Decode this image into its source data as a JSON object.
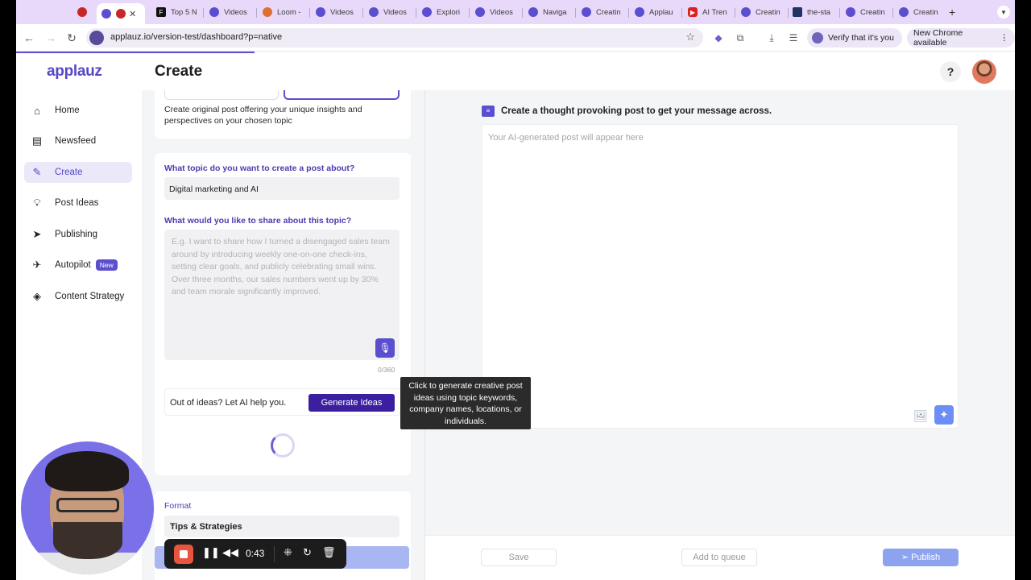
{
  "browser": {
    "tabs": [
      {
        "label": "",
        "icon": "record-icon",
        "color": "#c62828"
      },
      {
        "label": "",
        "icon": "applauz-icon",
        "color": "#5b4fcf"
      },
      {
        "label": "Top 5 N",
        "icon": "f-icon",
        "color": "#111111"
      },
      {
        "label": "Videos",
        "icon": "applauz-icon",
        "color": "#5b4fcf"
      },
      {
        "label": "Loom -",
        "icon": "loom-icon",
        "color": "#e07030"
      },
      {
        "label": "Videos",
        "icon": "applauz-icon",
        "color": "#5b4fcf"
      },
      {
        "label": "Videos",
        "icon": "applauz-icon",
        "color": "#5b4fcf"
      },
      {
        "label": "Explori",
        "icon": "applauz-icon",
        "color": "#5b4fcf"
      },
      {
        "label": "Videos",
        "icon": "applauz-icon",
        "color": "#5b4fcf"
      },
      {
        "label": "Naviga",
        "icon": "applauz-icon",
        "color": "#5b4fcf"
      },
      {
        "label": "Creatin",
        "icon": "applauz-icon",
        "color": "#5b4fcf"
      },
      {
        "label": "Applau",
        "icon": "applauz-icon",
        "color": "#5b4fcf"
      },
      {
        "label": "AI Tren",
        "icon": "youtube-icon",
        "color": "#e02020"
      },
      {
        "label": "Creatin",
        "icon": "applauz-icon",
        "color": "#5b4fcf"
      },
      {
        "label": "the-sta",
        "icon": "doc-icon",
        "color": "#223366"
      },
      {
        "label": "Creatin",
        "icon": "applauz-icon",
        "color": "#5b4fcf"
      },
      {
        "label": "Creatin",
        "icon": "applauz-icon",
        "color": "#5b4fcf"
      }
    ],
    "new_tab": "+",
    "url": "applauz.io/version-test/dashboard?p=native",
    "verify_label": "Verify that it's you",
    "new_chrome_label": "New Chrome available"
  },
  "app": {
    "logo": "applauz",
    "page_title": "Create",
    "help": "?"
  },
  "sidebar": {
    "items": [
      {
        "label": "Home",
        "icon": "home-icon"
      },
      {
        "label": "Newsfeed",
        "icon": "newsfeed-icon"
      },
      {
        "label": "Create",
        "icon": "pencil-icon",
        "active": true
      },
      {
        "label": "Post Ideas",
        "icon": "lightbulb-icon"
      },
      {
        "label": "Publishing",
        "icon": "send-icon"
      },
      {
        "label": "Autopilot",
        "icon": "airplane-icon",
        "badge": "New"
      },
      {
        "label": "Content Strategy",
        "icon": "layers-icon"
      }
    ]
  },
  "form": {
    "post_type_description": "Create original post offering your unique insights and perspectives on your chosen topic",
    "topic_label": "What topic do you want to create a post about?",
    "topic_value": "Digital marketing and AI",
    "share_label": "What would you like to share about this topic?",
    "share_placeholder": "E.g. I want to share how I turned a disengaged sales team around by introducing weekly one-on-one check-ins, setting clear goals, and publicly celebrating small wins. Over three months, our sales numbers went up by 30% and team morale significantly improved.",
    "char_counter": "0/360",
    "ideas_prompt": "Out of ideas? Let AI help you.",
    "generate_label": "Generate Ideas",
    "format_label": "Format",
    "format_value": "Tips & Strategies"
  },
  "tooltip": "Click to generate creative post ideas using topic keywords, company names, locations, or individuals.",
  "preview": {
    "header": "Create a thought provoking post to get your message across.",
    "placeholder": "Your AI-generated post will appear here"
  },
  "footer": {
    "save_label": "Save",
    "queue_label": "Add to queue",
    "publish_label": "Publish"
  },
  "recorder": {
    "time": "0:43"
  },
  "colors": {
    "brand": "#5b4fcf",
    "generate_button": "#3b1fa0",
    "publish_button": "#8ea3ef"
  }
}
